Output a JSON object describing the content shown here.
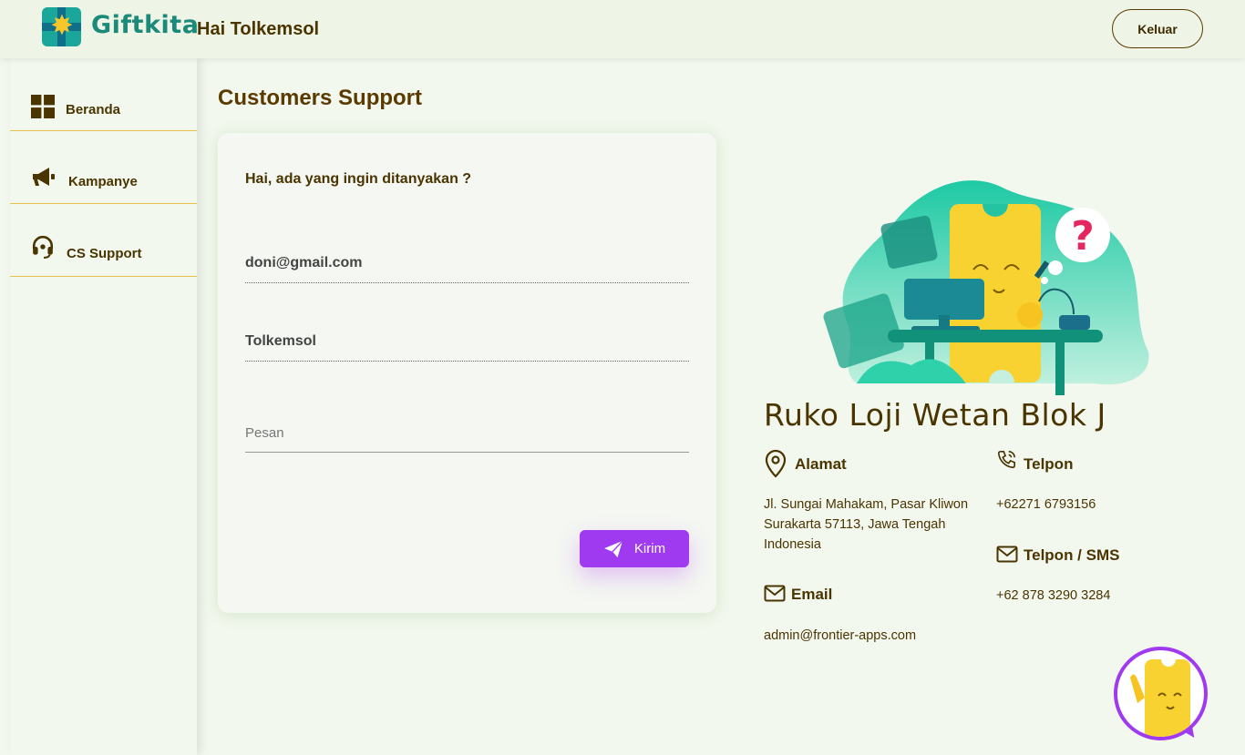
{
  "header": {
    "brand": "Giftkita",
    "greeting": "Hai Tolkemsol",
    "logout_label": "Keluar"
  },
  "sidebar": {
    "items": [
      {
        "label": "Beranda",
        "icon": "grid-icon"
      },
      {
        "label": "Kampanye",
        "icon": "megaphone-icon"
      },
      {
        "label": "CS Support",
        "icon": "headset-icon"
      }
    ]
  },
  "main": {
    "title": "Customers Support",
    "form": {
      "question": "Hai, ada yang ingin ditanyakan ?",
      "email_value": "doni@gmail.com",
      "name_value": "Tolkemsol",
      "message_placeholder": "Pesan",
      "send_label": "Kirim"
    }
  },
  "contact": {
    "office": "Ruko Loji Wetan Blok J",
    "address_label": "Alamat",
    "address_lines": [
      "Jl. Sungai Mahakam, Pasar Kliwon",
      "Surakarta 57113, Jawa Tengah",
      "Indonesia"
    ],
    "email_label": "Email",
    "email_value": "admin@frontier-apps.com",
    "phone_label": "Telpon",
    "phone_value": "+62271 6793156",
    "sms_label": "Telpon / SMS",
    "sms_value": "+62 878 3290 3284"
  },
  "colors": {
    "primary_text": "#4a3400",
    "accent": "#9f3af0",
    "brand": "#1b8a7a",
    "divider": "#e5c04a"
  }
}
